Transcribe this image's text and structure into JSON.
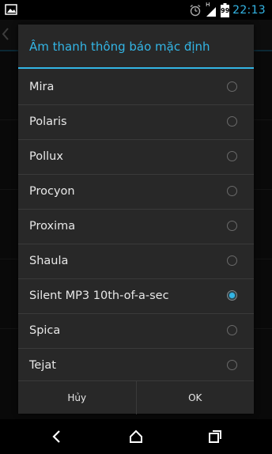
{
  "status_bar": {
    "time": "22:13",
    "battery_percent": "99",
    "network_label": "H",
    "icons": [
      "image-icon",
      "alarm-icon",
      "signal-icon",
      "battery-icon"
    ]
  },
  "dialog": {
    "title": "Âm thanh thông báo mặc định",
    "items": [
      {
        "label": "Mira",
        "selected": false
      },
      {
        "label": "Polaris",
        "selected": false
      },
      {
        "label": "Pollux",
        "selected": false
      },
      {
        "label": "Procyon",
        "selected": false
      },
      {
        "label": "Proxima",
        "selected": false
      },
      {
        "label": "Shaula",
        "selected": false
      },
      {
        "label": "Silent MP3 10th-of-a-sec",
        "selected": true
      },
      {
        "label": "Spica",
        "selected": false
      },
      {
        "label": "Tejat",
        "selected": false
      }
    ],
    "cancel_label": "Hủy",
    "ok_label": "OK"
  },
  "nav_bar": {
    "icons": [
      "back-icon",
      "home-icon",
      "recent-apps-icon"
    ]
  },
  "colors": {
    "accent": "#33b5e5",
    "dialog_background": "#282828",
    "divider": "#3a3a3a"
  }
}
